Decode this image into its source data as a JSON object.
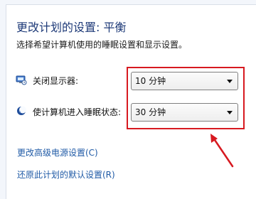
{
  "window": {
    "title": "更改计划的设置: 平衡",
    "subtitle": "选择希望计算机使用的睡眠设置和显示设置。"
  },
  "settings": [
    {
      "label": "关闭显示器:",
      "value": "10 分钟",
      "icon": "monitor-clock-icon"
    },
    {
      "label": "使计算机进入睡眠状态:",
      "value": "30 分钟",
      "icon": "moon-icon"
    }
  ],
  "links": {
    "advanced": "更改高级电源设置(C)",
    "restore": "还原此计划的默认设置(R)"
  },
  "colors": {
    "title": "#1e3a78",
    "link": "#1f5aa6",
    "annotation": "#d71920"
  }
}
